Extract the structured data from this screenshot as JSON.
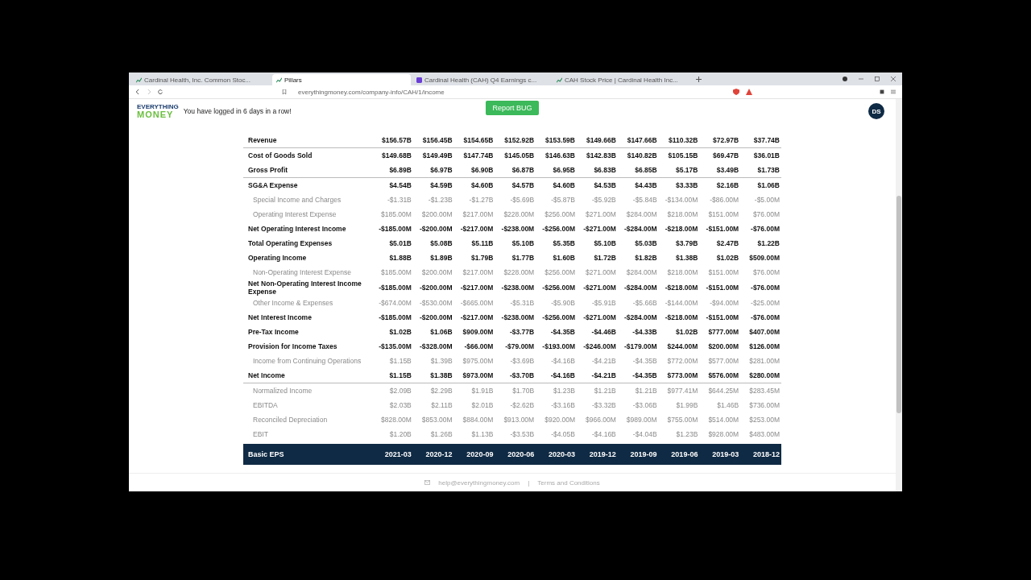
{
  "browser": {
    "tabs": [
      {
        "label": "Cardinal Health, Inc. Common Stoc...",
        "selected": false
      },
      {
        "label": "Pillars",
        "selected": true
      },
      {
        "label": "Cardinal Health (CAH) Q4 Earnings c...",
        "selected": false
      },
      {
        "label": "CAH Stock Price | Cardinal Health Inc...",
        "selected": false
      }
    ],
    "url": "everythingmoney.com/company-info/CAH/1/income"
  },
  "header": {
    "logo_top": "EVERYTHING",
    "logo_bottom": "MONEY",
    "streak": "You have logged in 6 days in a row!",
    "report_button": "Report BUG",
    "avatar": "DS"
  },
  "table": {
    "rows": [
      {
        "label": "Revenue",
        "kind": "main",
        "divider": true,
        "values": [
          "$156.57B",
          "$156.45B",
          "$154.65B",
          "$152.92B",
          "$153.59B",
          "$149.66B",
          "$147.66B",
          "$110.32B",
          "$72.97B",
          "$37.74B"
        ]
      },
      {
        "label": "Cost of Goods Sold",
        "kind": "main",
        "divider": false,
        "values": [
          "$149.68B",
          "$149.49B",
          "$147.74B",
          "$145.05B",
          "$146.63B",
          "$142.83B",
          "$140.82B",
          "$105.15B",
          "$69.47B",
          "$36.01B"
        ]
      },
      {
        "label": "Gross Profit",
        "kind": "main",
        "divider": true,
        "values": [
          "$6.89B",
          "$6.97B",
          "$6.90B",
          "$6.87B",
          "$6.95B",
          "$6.83B",
          "$6.85B",
          "$5.17B",
          "$3.49B",
          "$1.73B"
        ]
      },
      {
        "label": "SG&A Expense",
        "kind": "main",
        "divider": false,
        "values": [
          "$4.54B",
          "$4.59B",
          "$4.60B",
          "$4.57B",
          "$4.60B",
          "$4.53B",
          "$4.43B",
          "$3.33B",
          "$2.16B",
          "$1.06B"
        ]
      },
      {
        "label": "Special Income and Charges",
        "kind": "sub",
        "divider": false,
        "values": [
          "-$1.31B",
          "-$1.23B",
          "-$1.27B",
          "-$5.69B",
          "-$5.87B",
          "-$5.92B",
          "-$5.84B",
          "-$134.00M",
          "-$86.00M",
          "-$5.00M"
        ]
      },
      {
        "label": "Operating Interest Expense",
        "kind": "sub",
        "divider": false,
        "values": [
          "$185.00M",
          "$200.00M",
          "$217.00M",
          "$228.00M",
          "$256.00M",
          "$271.00M",
          "$284.00M",
          "$218.00M",
          "$151.00M",
          "$76.00M"
        ]
      },
      {
        "label": "Net Operating Interest Income",
        "kind": "main",
        "divider": false,
        "values": [
          "-$185.00M",
          "-$200.00M",
          "-$217.00M",
          "-$238.00M",
          "-$256.00M",
          "-$271.00M",
          "-$284.00M",
          "-$218.00M",
          "-$151.00M",
          "-$76.00M"
        ]
      },
      {
        "label": "Total Operating Expenses",
        "kind": "main",
        "divider": false,
        "values": [
          "$5.01B",
          "$5.08B",
          "$5.11B",
          "$5.10B",
          "$5.35B",
          "$5.10B",
          "$5.03B",
          "$3.79B",
          "$2.47B",
          "$1.22B"
        ]
      },
      {
        "label": "Operating Income",
        "kind": "main",
        "divider": false,
        "values": [
          "$1.88B",
          "$1.89B",
          "$1.79B",
          "$1.77B",
          "$1.60B",
          "$1.72B",
          "$1.82B",
          "$1.38B",
          "$1.02B",
          "$509.00M"
        ]
      },
      {
        "label": "Non-Operating Interest Expense",
        "kind": "sub",
        "divider": false,
        "values": [
          "$185.00M",
          "$200.00M",
          "$217.00M",
          "$228.00M",
          "$256.00M",
          "$271.00M",
          "$284.00M",
          "$218.00M",
          "$151.00M",
          "$76.00M"
        ]
      },
      {
        "label": "Net Non-Operating Interest Income Expense",
        "kind": "main",
        "divider": false,
        "values": [
          "-$185.00M",
          "-$200.00M",
          "-$217.00M",
          "-$238.00M",
          "-$256.00M",
          "-$271.00M",
          "-$284.00M",
          "-$218.00M",
          "-$151.00M",
          "-$76.00M"
        ]
      },
      {
        "label": "Other Income & Expenses",
        "kind": "sub",
        "divider": false,
        "values": [
          "-$674.00M",
          "-$530.00M",
          "-$665.00M",
          "-$5.31B",
          "-$5.90B",
          "-$5.91B",
          "-$5.66B",
          "-$144.00M",
          "-$94.00M",
          "-$25.00M"
        ]
      },
      {
        "label": "Net Interest Income",
        "kind": "main",
        "divider": false,
        "values": [
          "-$185.00M",
          "-$200.00M",
          "-$217.00M",
          "-$238.00M",
          "-$256.00M",
          "-$271.00M",
          "-$284.00M",
          "-$218.00M",
          "-$151.00M",
          "-$76.00M"
        ]
      },
      {
        "label": "Pre-Tax Income",
        "kind": "main",
        "divider": false,
        "values": [
          "$1.02B",
          "$1.06B",
          "$909.00M",
          "-$3.77B",
          "-$4.35B",
          "-$4.46B",
          "-$4.33B",
          "$1.02B",
          "$777.00M",
          "$407.00M"
        ]
      },
      {
        "label": "Provision for Income Taxes",
        "kind": "main",
        "divider": false,
        "values": [
          "-$135.00M",
          "-$328.00M",
          "-$66.00M",
          "-$79.00M",
          "-$193.00M",
          "-$246.00M",
          "-$179.00M",
          "$244.00M",
          "$200.00M",
          "$126.00M"
        ]
      },
      {
        "label": "Income from Continuing Operations",
        "kind": "sub",
        "divider": false,
        "values": [
          "$1.15B",
          "$1.39B",
          "$975.00M",
          "-$3.69B",
          "-$4.16B",
          "-$4.21B",
          "-$4.35B",
          "$772.00M",
          "$577.00M",
          "$281.00M"
        ]
      },
      {
        "label": "Net Income",
        "kind": "main",
        "divider": true,
        "values": [
          "$1.15B",
          "$1.38B",
          "$973.00M",
          "-$3.70B",
          "-$4.16B",
          "-$4.21B",
          "-$4.35B",
          "$773.00M",
          "$576.00M",
          "$280.00M"
        ]
      },
      {
        "label": "Normalized Income",
        "kind": "sub",
        "divider": false,
        "values": [
          "$2.09B",
          "$2.29B",
          "$1.91B",
          "$1.70B",
          "$1.23B",
          "$1.21B",
          "$1.21B",
          "$977.41M",
          "$644.25M",
          "$283.45M"
        ]
      },
      {
        "label": "EBITDA",
        "kind": "sub",
        "divider": false,
        "values": [
          "$2.03B",
          "$2.11B",
          "$2.01B",
          "-$2.62B",
          "-$3.16B",
          "-$3.32B",
          "-$3.06B",
          "$1.99B",
          "$1.46B",
          "$736.00M"
        ]
      },
      {
        "label": "Reconciled Depreciation",
        "kind": "sub",
        "divider": false,
        "values": [
          "$828.00M",
          "$853.00M",
          "$884.00M",
          "$913.00M",
          "$920.00M",
          "$966.00M",
          "$989.00M",
          "$755.00M",
          "$514.00M",
          "$253.00M"
        ]
      },
      {
        "label": "EBIT",
        "kind": "sub",
        "divider": false,
        "values": [
          "$1.20B",
          "$1.26B",
          "$1.13B",
          "-$3.53B",
          "-$4.05B",
          "-$4.16B",
          "-$4.04B",
          "$1.23B",
          "$928.00M",
          "$483.00M"
        ]
      }
    ],
    "section_header": {
      "label": "Basic EPS",
      "periods": [
        "2021-03",
        "2020-12",
        "2020-09",
        "2020-06",
        "2020-03",
        "2019-12",
        "2019-09",
        "2019-06",
        "2019-03",
        "2018-12"
      ]
    }
  },
  "footer": {
    "email": "help@everythingmoney.com",
    "separator": "|",
    "terms": "Terms and Conditions"
  }
}
